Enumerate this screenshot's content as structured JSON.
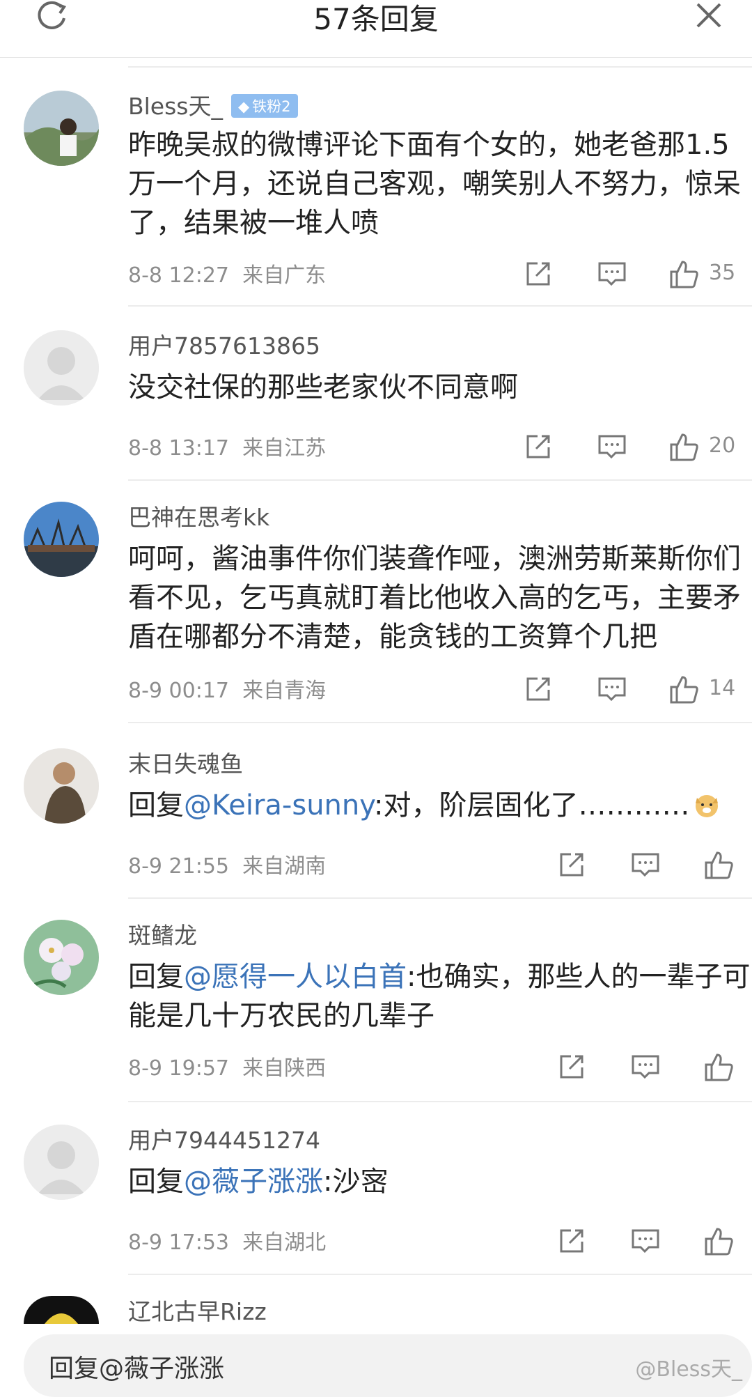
{
  "header": {
    "title": "57条回复"
  },
  "comments": [
    {
      "user": "Bless天_",
      "badge": "铁粉2",
      "text": "昨晚吴叔的微博评论下面有个女的，她老爸那1.5万一个月，还说自己客观，嘲笑别人不努力，惊呆了，结果被一堆人喷",
      "time": "8-8 12:27",
      "location": "来自广东",
      "likes": "35"
    },
    {
      "user": "用户7857613865",
      "text": "没交社保的那些老家伙不同意啊",
      "time": "8-8 13:17",
      "location": "来自江苏",
      "likes": "20"
    },
    {
      "user": "巴神在思考kk",
      "text": "呵呵，酱油事件你们装聋作哑，澳洲劳斯莱斯你们看不见，乞丐真就盯着比他收入高的乞丐，主要矛盾在哪都分不清楚，能贪钱的工资算个几把",
      "time": "8-9 00:17",
      "location": "来自青海",
      "likes": "14"
    },
    {
      "user": "末日失魂鱼",
      "reply_prefix": "回复",
      "mention": "@Keira-sunny",
      "text": ":对，阶层固化了…………",
      "time": "8-9 21:55",
      "location": "来自湖南"
    },
    {
      "user": "斑鳍龙",
      "reply_prefix": "回复",
      "mention": "@愿得一人以白首",
      "text": ":也确实，那些人的一辈子可能是几十万农民的几辈子",
      "time": "8-9 19:57",
      "location": "来自陕西"
    },
    {
      "user": "用户7944451274",
      "reply_prefix": "回复",
      "mention": "@薇子涨涨",
      "text": ":沙宻",
      "time": "8-9 17:53",
      "location": "来自湖北"
    },
    {
      "user": "辽北古早Rizz"
    }
  ],
  "reply_input": {
    "text": "回复@薇子涨涨"
  },
  "watermark": "@Bless天_",
  "icons": [
    "refresh-icon",
    "close-icon",
    "share-icon",
    "comment-icon",
    "like-icon",
    "emoji-icon"
  ]
}
